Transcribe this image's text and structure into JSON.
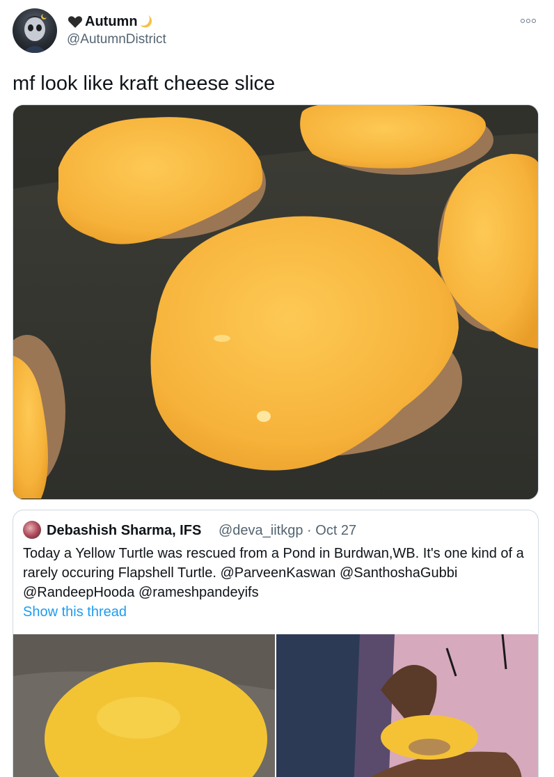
{
  "author": {
    "display_name": "Autumn",
    "handle": "@AutumnDistrict",
    "name_prefix_icon": "black-heart-icon",
    "name_suffix_icon": "crescent-moon-icon"
  },
  "more_icon": "more-options-icon",
  "tweet_text": "mf look like kraft cheese slice",
  "quote": {
    "display_name": "Debashish Sharma, IFS",
    "handle_and_date": "@deva_iitkgp · Oct 27",
    "text": "Today a Yellow Turtle was rescued from a Pond in Burdwan,WB. It's one kind of a rarely occuring Flapshell Turtle. @ParveenKaswan @SanthoshaGubbi @RandeepHooda @rameshpandeyifs",
    "show_thread_label": "Show this thread"
  },
  "colors": {
    "link_blue": "#1d9bf0",
    "secondary_text": "#536471",
    "border": "#cfd9de",
    "cheese_yellow": "#f7b53a"
  }
}
